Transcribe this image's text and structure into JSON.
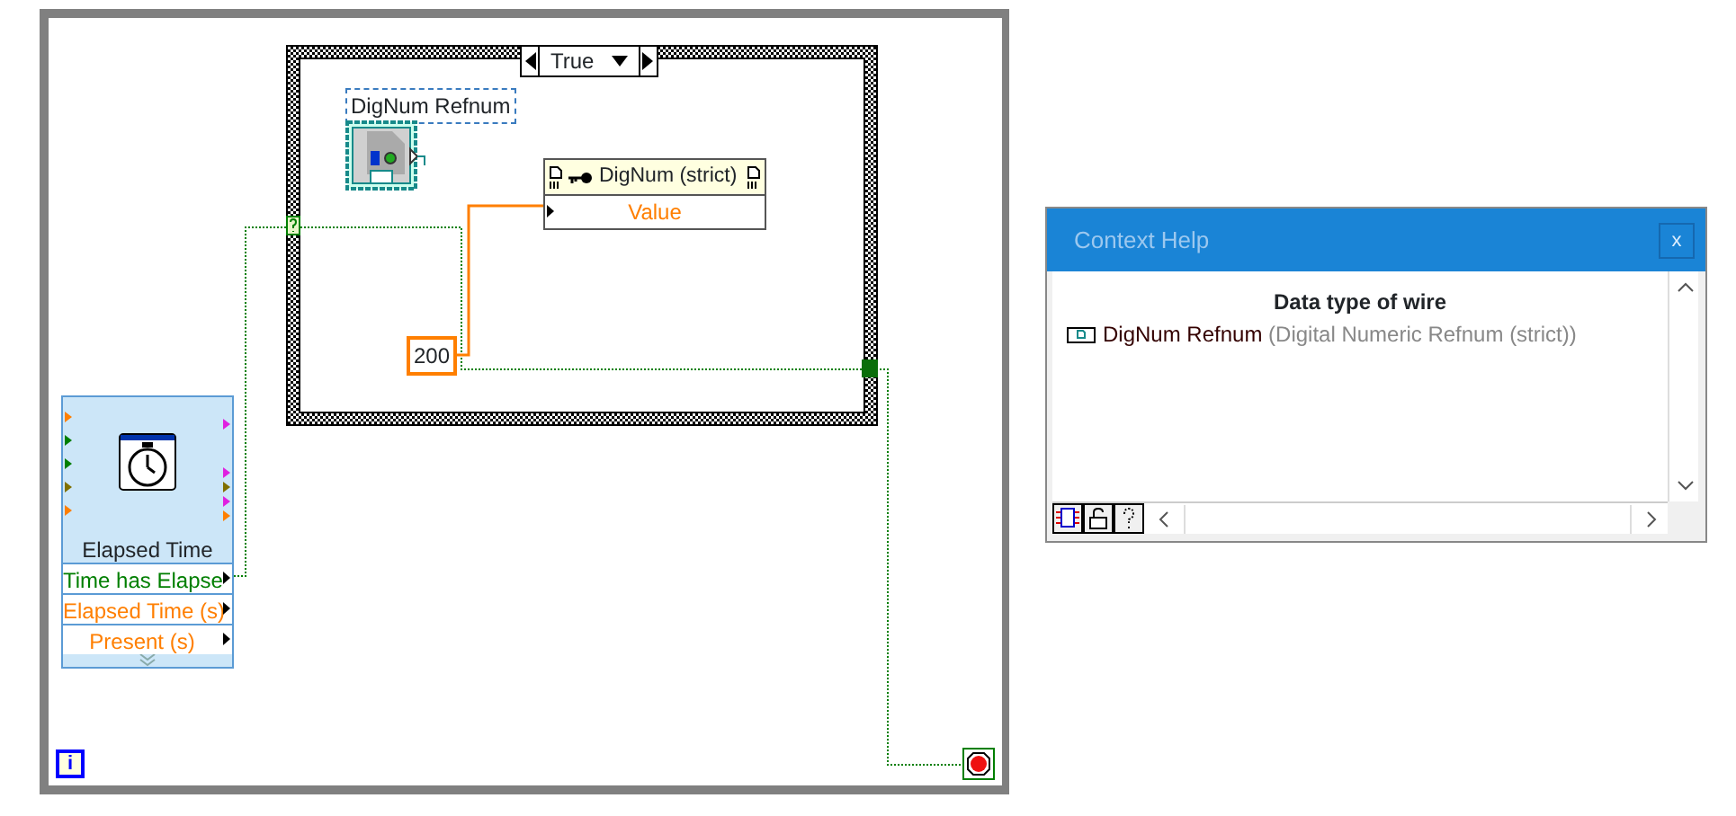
{
  "loop": {
    "iteration_terminal": "i"
  },
  "case_structure": {
    "selector_value": "True"
  },
  "refnum": {
    "label": "DigNum Refnum"
  },
  "property_node": {
    "class_name": "DigNum (strict)",
    "properties": [
      {
        "name": "Value",
        "color": "#ff7f00"
      }
    ]
  },
  "constant": {
    "value": "200"
  },
  "express_vi": {
    "title": "Elapsed Time",
    "outputs": [
      {
        "label": "Time has Elapse",
        "color": "#007f00"
      },
      {
        "label": "Elapsed Time (s)",
        "color": "#ff7f00"
      },
      {
        "label": "Present (s)",
        "color": "#ff7f00"
      }
    ]
  },
  "context_help": {
    "title": "Context Help",
    "close": "x",
    "heading": "Data type of wire",
    "type_name": "DigNum Refnum",
    "type_description": "(Digital Numeric Refnum  (strict))"
  }
}
